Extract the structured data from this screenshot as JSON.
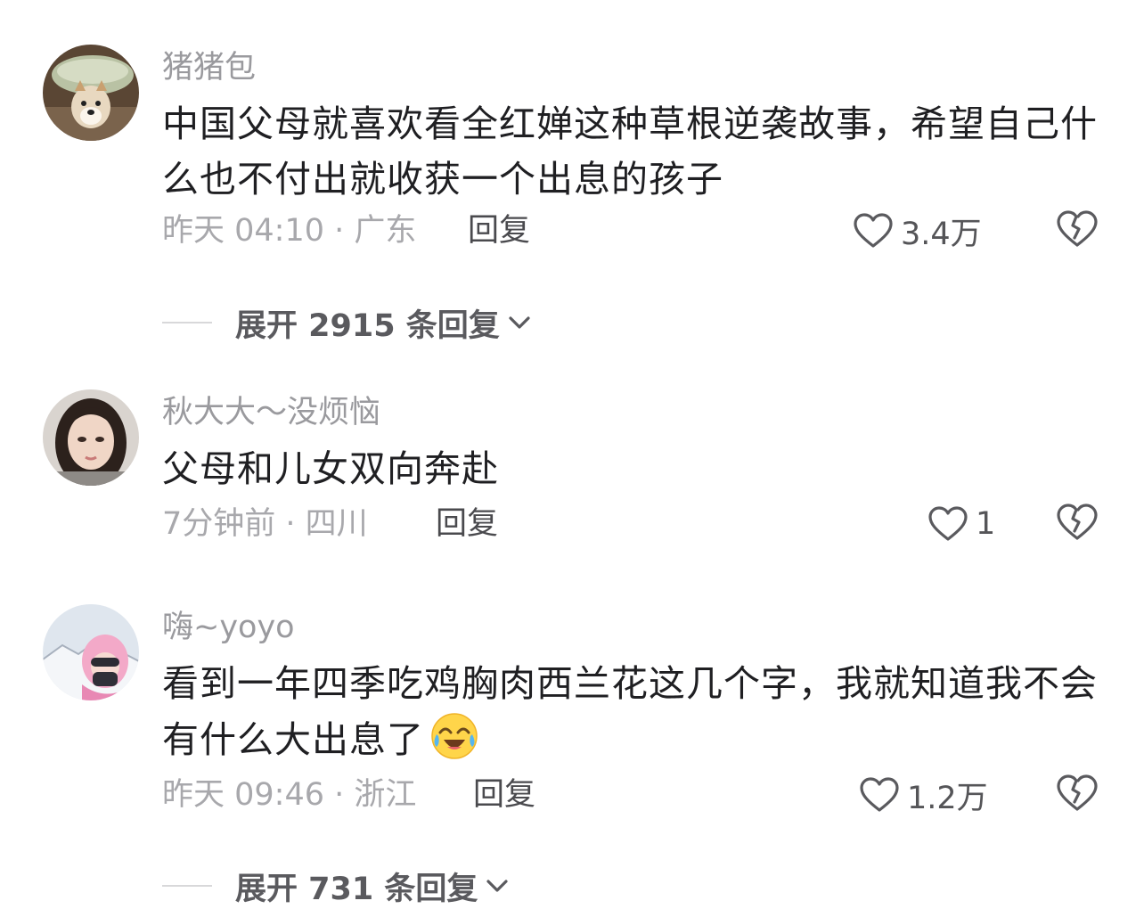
{
  "comments": [
    {
      "username": "猪猪包",
      "text": "中国父母就喜欢看全红婵这种草根逆袭故事，希望自己什么也不付出就收获一个出息的孩子",
      "meta": "昨天 04:10 · 广东",
      "reply_label": "回复",
      "like_count": "3.4万",
      "avatar_icon": "dog-avatar",
      "expand_label": "展开 2915 条回复"
    },
    {
      "username": "秋大大～没烦恼",
      "text": "父母和儿女双向奔赴",
      "meta": "7分钟前 · 四川",
      "reply_label": "回复",
      "like_count": "1",
      "avatar_icon": "woman-avatar"
    },
    {
      "username": "嗨~yoyo",
      "text": "看到一年四季吃鸡胸肉西兰花这几个字，我就知道我不会有什么大出息了",
      "meta": "昨天 09:46 · 浙江",
      "reply_label": "回复",
      "like_count": "1.2万",
      "avatar_icon": "skier-avatar",
      "emoji_icon": "laugh-cry-emoji",
      "expand_label": "展开 731 条回复"
    }
  ],
  "colors": {
    "username": "#9a9a9e",
    "text": "#1f1f22",
    "meta": "#a8a8ac",
    "action": "#4a4a4e"
  }
}
